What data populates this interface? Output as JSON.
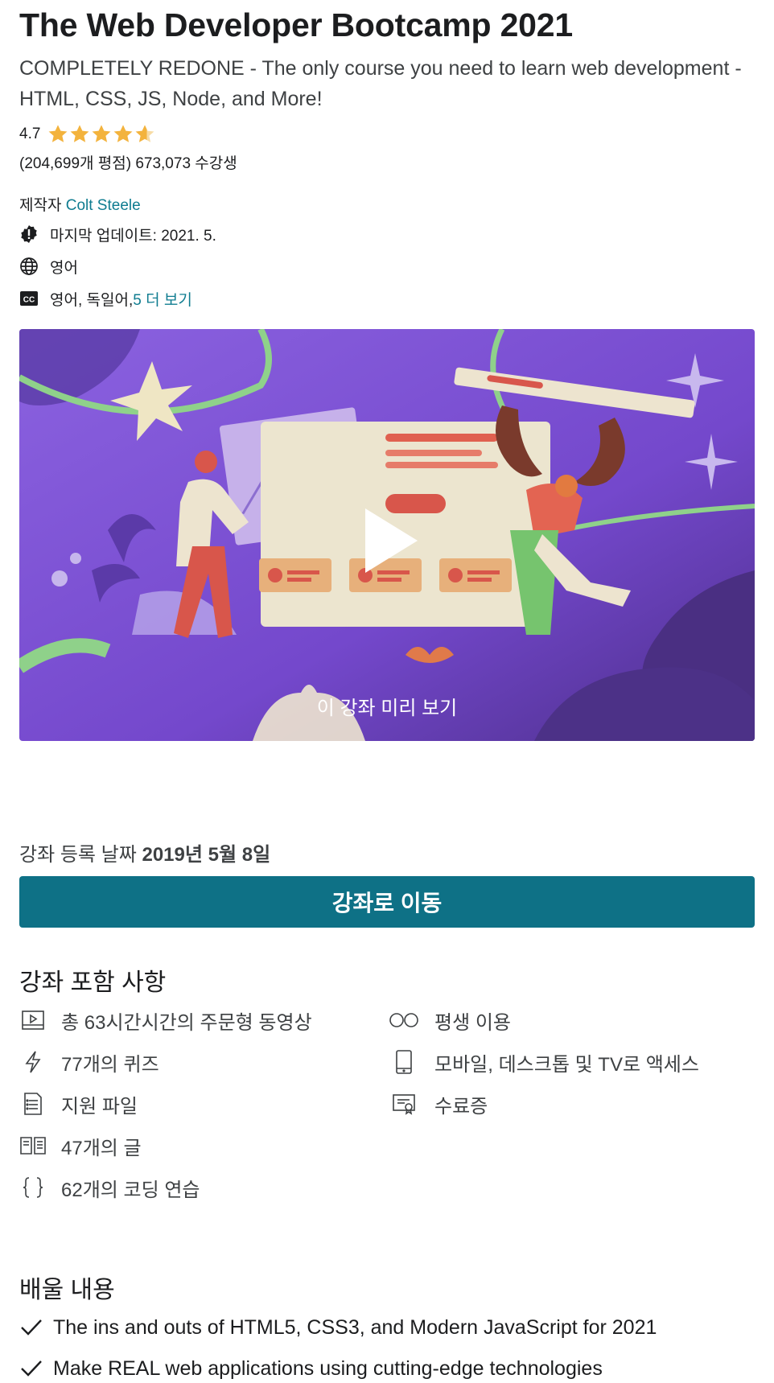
{
  "course": {
    "title": "The Web Developer Bootcamp 2021",
    "subtitle": "COMPLETELY REDONE - The only course you need to learn web development - HTML, CSS, JS, Node, and More!",
    "rating": "4.7",
    "rating_stars": 4.7,
    "counts": "(204,699개 평점) 673,073 수강생",
    "creator_prefix": "제작자 ",
    "creator_name": "Colt Steele",
    "last_updated": "마지막 업데이트: 2021. 5.",
    "language": "영어",
    "captions": "영어, 독일어, ",
    "captions_more": "5 더 보기"
  },
  "preview": {
    "label": "이 강좌 미리 보기"
  },
  "enrollment": {
    "prefix": "강좌 등록 날짜 ",
    "date": "2019년 5월 8일"
  },
  "cta": {
    "label": "강좌로 이동"
  },
  "includes": {
    "heading": "강좌 포함 사항",
    "left": [
      {
        "icon": "video-icon",
        "label": "총 63시간시간의 주문형 동영상"
      },
      {
        "icon": "lightning-icon",
        "label": "77개의 퀴즈"
      },
      {
        "icon": "file-list-icon",
        "label": "지원 파일"
      },
      {
        "icon": "article-icon",
        "label": "47개의 글"
      },
      {
        "icon": "code-braces-icon",
        "label": "62개의 코딩 연습"
      }
    ],
    "right": [
      {
        "icon": "infinity-icon",
        "label": "평생 이용"
      },
      {
        "icon": "mobile-icon",
        "label": "모바일, 데스크톱 및 TV로 액세스"
      },
      {
        "icon": "certificate-icon",
        "label": "수료증"
      }
    ]
  },
  "learn": {
    "heading": "배울 내용",
    "items": [
      "The ins and outs of HTML5, CSS3, and Modern JavaScript for 2021",
      "Make REAL web applications using cutting-edge technologies"
    ]
  },
  "colors": {
    "accent": "#0e7186",
    "link": "#0f7c90",
    "star": "#f3b33d",
    "preview_bg": "#7b54d4"
  }
}
